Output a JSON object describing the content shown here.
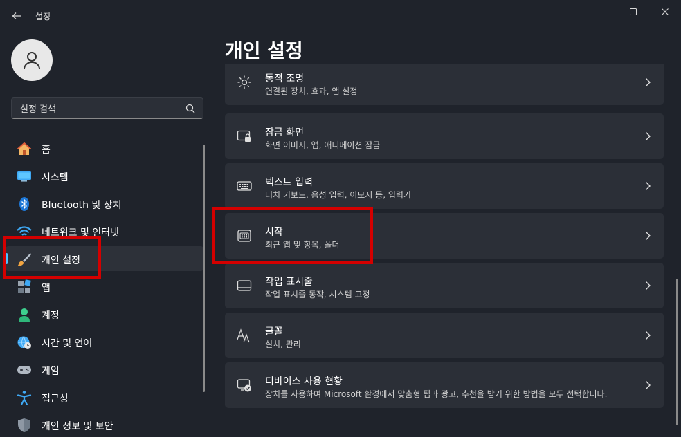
{
  "window": {
    "title": "설정",
    "back_icon": "back-arrow-icon",
    "controls": [
      "minimize-icon",
      "maximize-icon",
      "close-icon"
    ]
  },
  "search": {
    "placeholder": "설정 검색",
    "icon": "search-icon"
  },
  "sidebar": {
    "items": [
      {
        "label": "홈",
        "icon": "home-icon"
      },
      {
        "label": "시스템",
        "icon": "monitor-icon"
      },
      {
        "label": "Bluetooth 및 장치",
        "icon": "bluetooth-icon"
      },
      {
        "label": "네트워크 및 인터넷",
        "icon": "wifi-icon"
      },
      {
        "label": "개인 설정",
        "icon": "paintbrush-icon",
        "selected": true
      },
      {
        "label": "앱",
        "icon": "apps-icon"
      },
      {
        "label": "계정",
        "icon": "person-icon"
      },
      {
        "label": "시간 및 언어",
        "icon": "globe-clock-icon"
      },
      {
        "label": "게임",
        "icon": "gamepad-icon"
      },
      {
        "label": "접근성",
        "icon": "accessibility-icon"
      },
      {
        "label": "개인 정보 및 보안",
        "icon": "shield-icon"
      }
    ]
  },
  "page": {
    "title": "개인 설정"
  },
  "cards": [
    {
      "title": "동적 조명",
      "subtitle": "연결된 장치, 효과, 앱 설정",
      "icon": "dynamic-lighting-icon"
    },
    {
      "title": "잠금 화면",
      "subtitle": "화면 이미지, 앱, 애니메이션 잠금",
      "icon": "lock-screen-icon"
    },
    {
      "title": "텍스트 입력",
      "subtitle": "터치 키보드, 음성 입력, 이모지 등, 입력기",
      "icon": "keyboard-icon"
    },
    {
      "title": "시작",
      "subtitle": "최근 앱 및 항목, 폴더",
      "icon": "start-menu-icon"
    },
    {
      "title": "작업 표시줄",
      "subtitle": "작업 표시줄 동작, 시스템 고정",
      "icon": "taskbar-icon"
    },
    {
      "title": "글꼴",
      "subtitle": "설치, 관리",
      "icon": "fonts-icon"
    },
    {
      "title": "디바이스 사용 현황",
      "subtitle": "장치를 사용하여 Microsoft 환경에서 맞춤형 팁과 광고, 추천을 받기 위한 방법을 모두 선택합니다.",
      "icon": "device-usage-icon"
    }
  ],
  "colors": {
    "accent": "#4cc2ff",
    "highlight": "#d40000",
    "background": "#1f232b",
    "card": "#2b2f37"
  }
}
